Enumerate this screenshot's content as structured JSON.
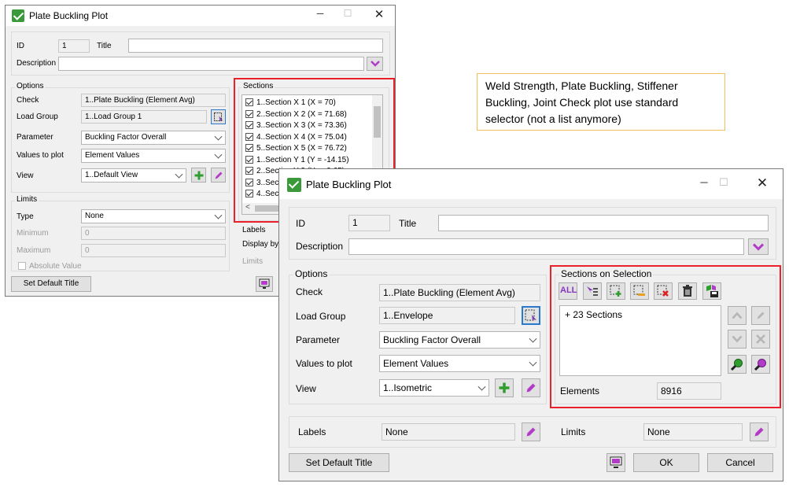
{
  "note": {
    "text": "Weld Strength, Plate Buckling, Stiffener Buckling, Joint Check plot use standard selector (not a list anymore)"
  },
  "old_dialog": {
    "title": "Plate Buckling Plot",
    "id_label": "ID",
    "id_value": "1",
    "title_label": "Title",
    "title_value": "",
    "description_label": "Description",
    "options_label": "Options",
    "check_label": "Check",
    "check_value": "1..Plate Buckling (Element Avg)",
    "load_group_label": "Load Group",
    "load_group_value": "1..Load Group 1",
    "parameter_label": "Parameter",
    "parameter_value": "Buckling Factor Overall",
    "values_label": "Values to plot",
    "values_value": "Element Values",
    "view_label": "View",
    "view_value": "1..Default View",
    "limits_label": "Limits",
    "type_label": "Type",
    "type_value": "None",
    "minimum_label": "Minimum",
    "minimum_value": "0",
    "maximum_label": "Maximum",
    "maximum_value": "0",
    "absolute_label": "Absolute Value",
    "sections_label": "Sections",
    "sections": [
      "1..Section X 1 (X = 70)",
      "2..Section X 2 (X = 71.68)",
      "3..Section X 3 (X = 73.36)",
      "4..Section X 4 (X = 75.04)",
      "5..Section X 5 (X = 76.72)",
      "1..Section Y 1 (Y = -14.15)",
      "2..Section Y 2 (Y = -9.65)",
      "3..Sect",
      "4..Sect"
    ],
    "labels_label": "Labels",
    "display_by_label": "Display by",
    "limits2_label": "Limits",
    "set_default_label": "Set Default Title"
  },
  "new_dialog": {
    "title": "Plate Buckling Plot",
    "id_label": "ID",
    "id_value": "1",
    "title_label": "Title",
    "title_value": "",
    "description_label": "Description",
    "options_label": "Options",
    "check_label": "Check",
    "check_value": "1..Plate Buckling (Element Avg)",
    "load_group_label": "Load Group",
    "load_group_value": "1..Envelope",
    "parameter_label": "Parameter",
    "parameter_value": "Buckling Factor Overall",
    "values_label": "Values to plot",
    "values_value": "Element Values",
    "view_label": "View",
    "view_value": "1..Isometric",
    "sections_label": "Sections on Selection",
    "selection_item": "+ 23 Sections",
    "elements_label": "Elements",
    "elements_value": "8916",
    "labels_label": "Labels",
    "labels_value": "None",
    "limits_label": "Limits",
    "limits_value": "None",
    "set_default_label": "Set Default Title",
    "ok_label": "OK",
    "cancel_label": "Cancel"
  },
  "colors": {
    "highlight": "#e8212b",
    "note_border": "#f0c060",
    "app_icon": "#3a9a3a"
  }
}
